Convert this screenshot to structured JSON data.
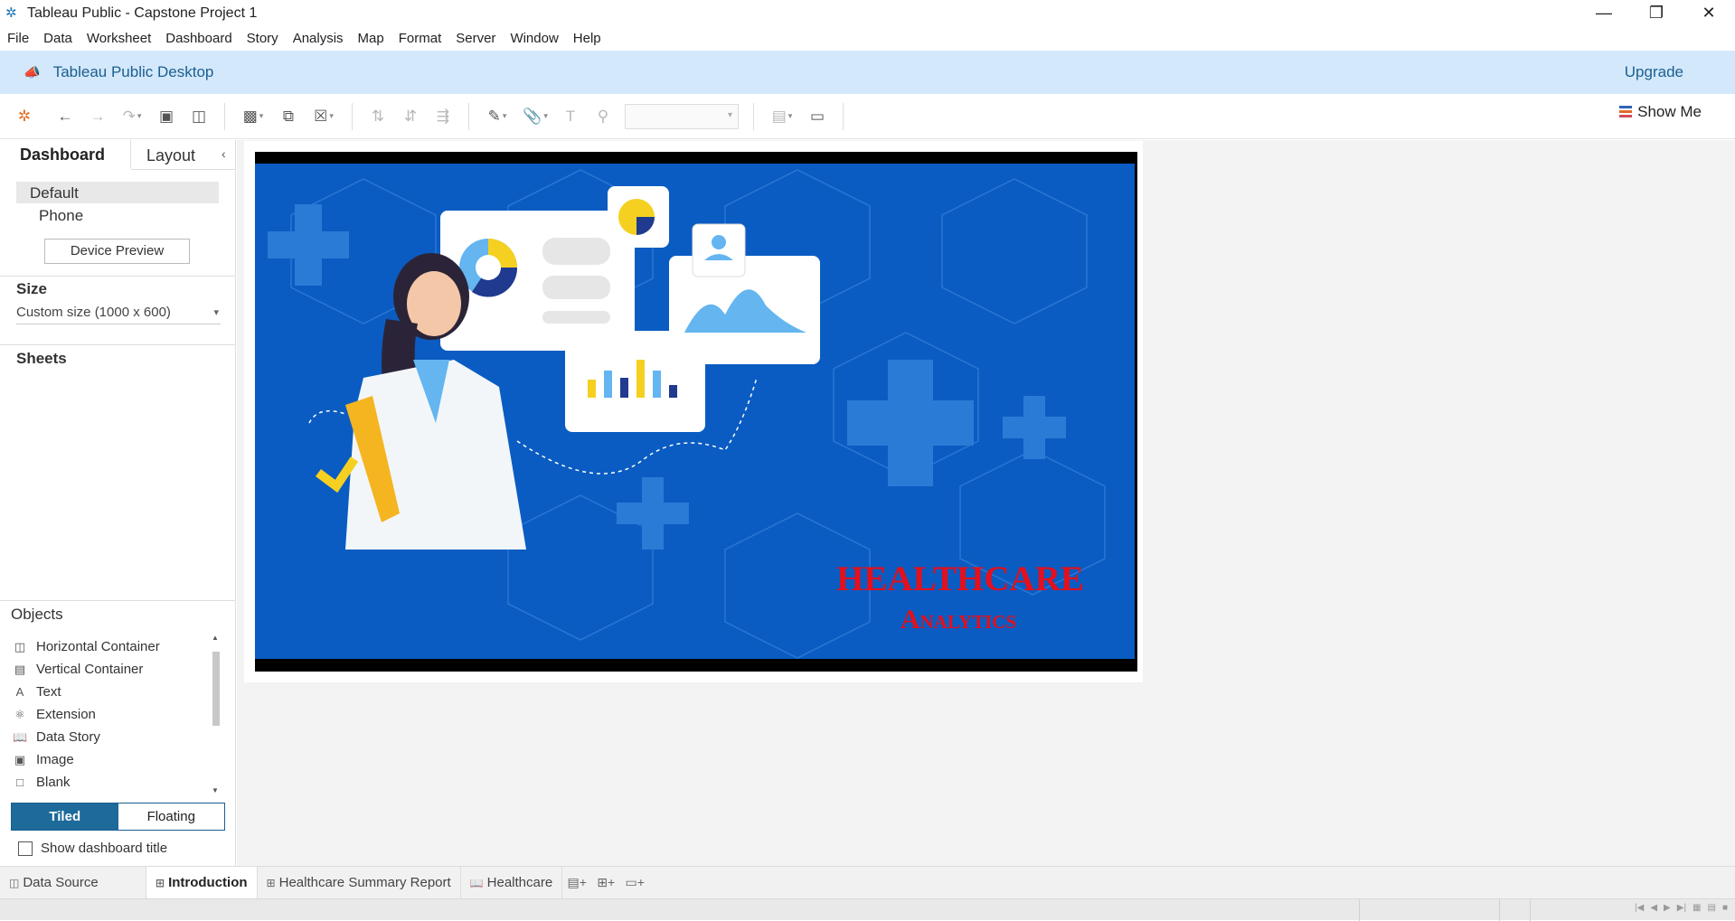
{
  "window": {
    "title": "Tableau Public - Capstone Project 1",
    "controls": [
      "minimize",
      "restore",
      "close"
    ]
  },
  "menu": [
    "File",
    "Data",
    "Worksheet",
    "Dashboard",
    "Story",
    "Analysis",
    "Map",
    "Format",
    "Server",
    "Window",
    "Help"
  ],
  "banner": {
    "product": "Tableau Public Desktop",
    "upgrade": "Upgrade"
  },
  "toolbar": {
    "show_me": "Show Me"
  },
  "left_panel": {
    "tabs": {
      "dashboard": "Dashboard",
      "layout": "Layout"
    },
    "devices": {
      "default": "Default",
      "phone": "Phone"
    },
    "device_preview": "Device Preview",
    "size": {
      "heading": "Size",
      "value": "Custom size (1000 x 600)"
    },
    "sheets": {
      "heading": "Sheets"
    },
    "objects": {
      "heading": "Objects",
      "items": [
        {
          "label": "Horizontal Container",
          "icon": "horizontal-container-icon"
        },
        {
          "label": "Vertical Container",
          "icon": "vertical-container-icon"
        },
        {
          "label": "Text",
          "icon": "text-icon"
        },
        {
          "label": "Extension",
          "icon": "extension-icon"
        },
        {
          "label": "Data Story",
          "icon": "data-story-icon"
        },
        {
          "label": "Image",
          "icon": "image-icon"
        },
        {
          "label": "Blank",
          "icon": "blank-icon"
        }
      ]
    },
    "layout_mode": {
      "tiled": "Tiled",
      "floating": "Floating",
      "selected": "Tiled"
    },
    "show_title": {
      "label": "Show dashboard title",
      "checked": false
    }
  },
  "dashboard_image": {
    "headline_1": "HEALTHCARE",
    "headline_2": "Analytics",
    "colors": {
      "background": "#0a5cc2",
      "headline": "#e3101d",
      "accent_yellow": "#f5d020",
      "accent_navy": "#1f3a8f",
      "accent_light_blue": "#64b5f0"
    }
  },
  "sheet_tabs": [
    {
      "label": "Data Source",
      "icon": "data-source-icon",
      "active": false
    },
    {
      "label": "Introduction",
      "icon": "dashboard-icon",
      "active": true
    },
    {
      "label": "Healthcare Summary Report",
      "icon": "dashboard-icon",
      "active": false
    },
    {
      "label": "Healthcare",
      "icon": "story-icon",
      "active": false
    }
  ]
}
